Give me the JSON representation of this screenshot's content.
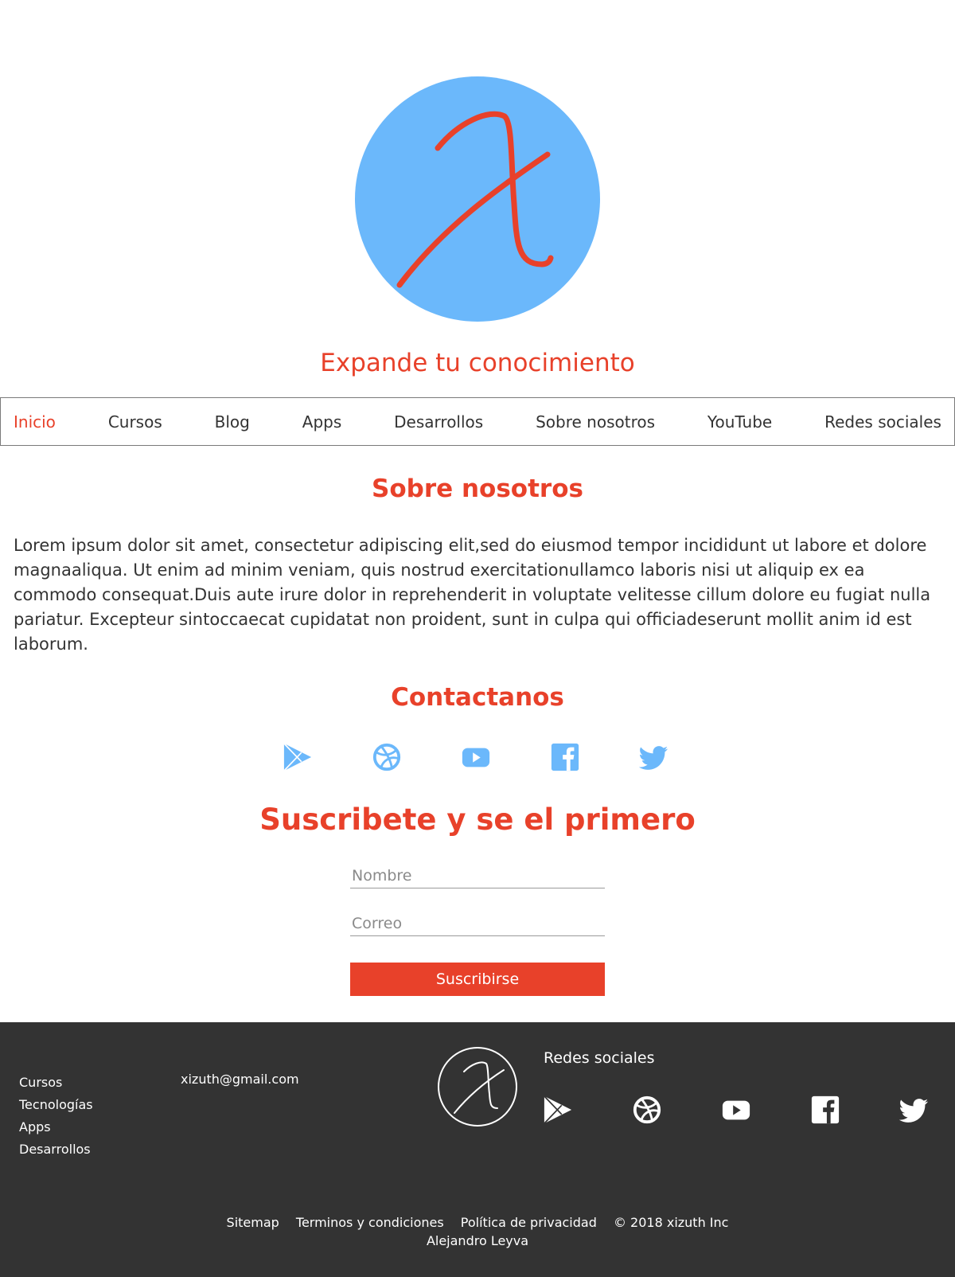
{
  "header": {
    "tagline": "Expande tu conocimiento"
  },
  "nav": {
    "items": [
      "Inicio",
      "Cursos",
      "Blog",
      "Apps",
      "Desarrollos",
      "Sobre nosotros",
      "YouTube",
      "Redes sociales"
    ],
    "active": "Inicio"
  },
  "about": {
    "title": "Sobre nosotros",
    "body": "Lorem ipsum dolor sit amet, consectetur adipiscing elit,sed do eiusmod tempor incididunt ut labore et dolore magnaaliqua. Ut enim ad minim veniam, quis nostrud exercitationullamco laboris nisi ut aliquip ex ea commodo consequat.Duis aute irure dolor in reprehenderit in voluptate velitesse cillum dolore eu fugiat nulla pariatur. Excepteur sintoccaecat cupidatat non proident, sunt in culpa qui officiadeserunt mollit anim id est laborum."
  },
  "contact": {
    "title": "Contactanos",
    "icons": [
      "google-play-icon",
      "dribbble-icon",
      "youtube-icon",
      "facebook-icon",
      "twitter-icon"
    ]
  },
  "subscribe": {
    "title": "Suscribete y se el primero",
    "name_placeholder": "Nombre",
    "email_placeholder": "Correo",
    "button_label": "Suscribirse"
  },
  "footer": {
    "links": [
      "Cursos",
      "Tecnologías",
      "Apps",
      "Desarrollos"
    ],
    "email": "xizuth@gmail.com",
    "social_title": "Redes sociales",
    "legal": {
      "sitemap": "Sitemap",
      "terms": "Terminos y condiciones",
      "privacy": "Política de privacidad",
      "copyright": "© 2018 xizuth Inc"
    },
    "author": "Alejandro Leyva"
  },
  "colors": {
    "accent": "#e8412a",
    "logo_bg": "#6bb8fb",
    "icon_blue": "#6bb8fb",
    "footer_bg": "#333333"
  }
}
